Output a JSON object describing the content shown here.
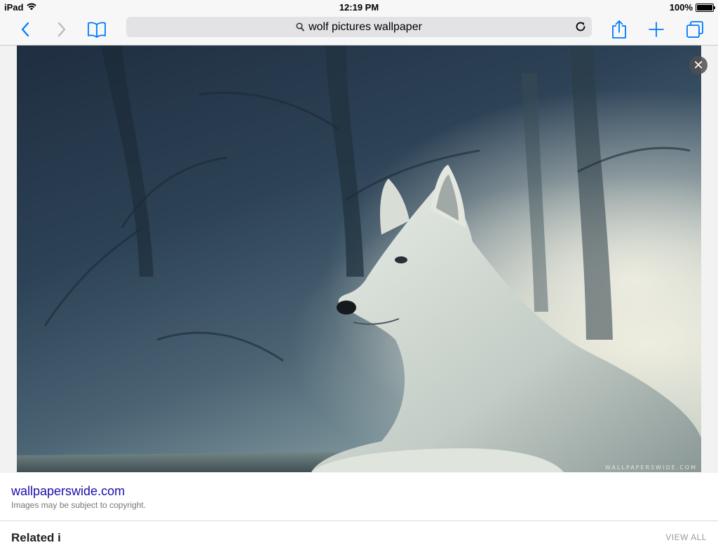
{
  "status_bar": {
    "device": "iPad",
    "time": "12:19 PM",
    "battery": "100%"
  },
  "toolbar": {
    "query": "wolf pictures wallpaper",
    "icons": {
      "back": "chevron-left-icon",
      "forward": "chevron-right-icon",
      "bookmarks": "book-icon",
      "search": "magnifier-icon",
      "reload": "reload-icon",
      "share": "share-icon",
      "new_tab": "plus-icon",
      "tabs": "tabs-icon"
    },
    "accent_color": "#007aff"
  },
  "image": {
    "watermark": "WALLPAPERSWIDE.COM",
    "close_label": "✕"
  },
  "caption": {
    "site": "wallpaperswide.com",
    "note": "Images may be subject to copyright."
  },
  "related": {
    "heading": "Related i",
    "view_all": "VIEW ALL"
  }
}
